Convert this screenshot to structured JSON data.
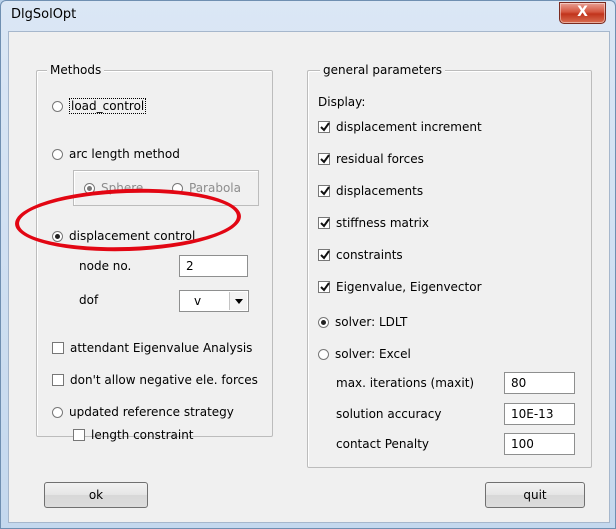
{
  "window": {
    "title": "DlgSolOpt",
    "close_label": "X"
  },
  "methods": {
    "legend": "Methods",
    "load_control": "load_control",
    "arc_length": "arc length method",
    "sphere": "Sphere",
    "parabola": "Parabola",
    "displacement_control": "displacement control",
    "node_label": "node no.",
    "node_value": "2",
    "dof_label": "dof",
    "dof_value": "v",
    "eigen_analysis": "attendant Eigenvalue Analysis",
    "no_negative": "don't allow negative ele. forces",
    "updated_strategy": "updated reference strategy",
    "length_constraint": "length constraint",
    "selected_method": "displacement control",
    "selected_arc_option": "Sphere"
  },
  "general": {
    "legend": "general parameters",
    "display_label": "Display:",
    "checks": [
      {
        "label": "displacement increment",
        "checked": true
      },
      {
        "label": "residual forces",
        "checked": true
      },
      {
        "label": "displacements",
        "checked": true
      },
      {
        "label": "stiffness matrix",
        "checked": true
      },
      {
        "label": "constraints",
        "checked": true
      },
      {
        "label": "Eigenvalue, Eigenvector",
        "checked": true
      }
    ],
    "solver_ldlt": "solver: LDLT",
    "solver_excel": "solver: Excel",
    "selected_solver": "solver: LDLT",
    "max_iter_label": "max. iterations (maxit)",
    "max_iter_value": "80",
    "accuracy_label": "solution accuracy",
    "accuracy_value": "10E-13",
    "penalty_label": "contact Penalty",
    "penalty_value": "100"
  },
  "buttons": {
    "ok": "ok",
    "quit": "quit"
  },
  "colors": {
    "annotation": "#e20613"
  }
}
